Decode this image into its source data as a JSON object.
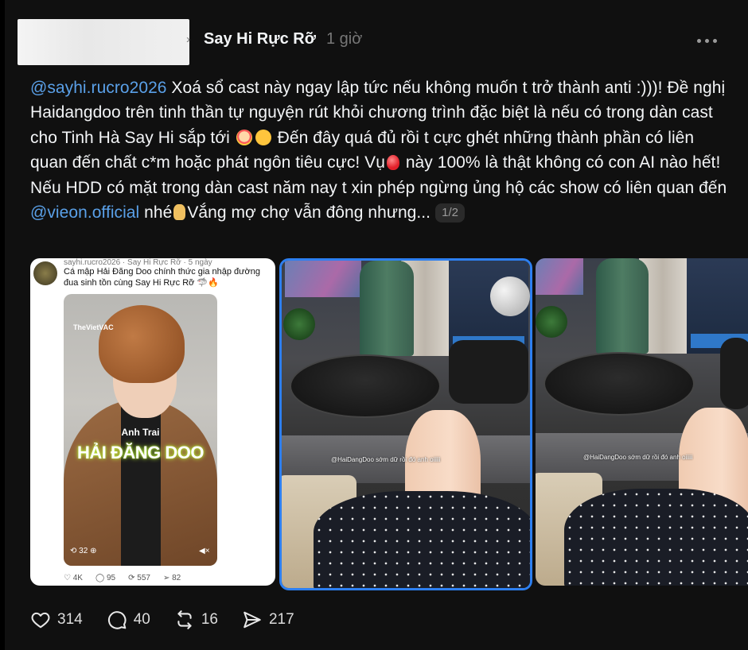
{
  "header": {
    "username": "Say Hi Rực Rỡ",
    "time": "1 giờ"
  },
  "post": {
    "mention_1": "@sayhi.rucro2026",
    "text_1": " Xoá sổ cast này ngay lập tức nếu không muốn t trở thành anti :)))! Đề nghị Haidangdoo trên tinh thần tự nguyện rút khỏi chương trình đặc biệt là nếu có trong dàn cast cho Tinh Hà Say Hi sắp tới",
    "text_2": " Đến đây quá đủ rồi t cực ghét những thành phần có liên quan đến chất c*m hoặc phát ngôn tiêu cực! Vụ",
    "text_3": " này 100% là thật không có con AI nào hết! Nếu HDD có mặt trong dàn cast năm nay t xin phép ngừng ủng hộ các show có liên quan đến ",
    "mention_2": "@vieon.official",
    "text_4": " nhé",
    "text_5": "Vắng mợ chợ vẫn đông nhưng...",
    "page_indicator": "1/2",
    "emoji_icons": [
      "clown-emoji",
      "sad-face-emoji",
      "balloon-emoji",
      "crossed-fingers-emoji"
    ]
  },
  "media": {
    "screenshot": {
      "header": "sayhi.rucro2026 · Say Hi Rực Rỡ · 5 ngày",
      "caption": "Cá mập Hải Đăng Doo chính thức gia nhập đường đua sinh tồn cùng Say Hi Rực Rỡ 🦈🔥",
      "watermark": "TheVietVAC",
      "subtitle": "Anh Trai",
      "title": "HẢI ĐĂNG DOO",
      "views": "32",
      "likes": "4K",
      "comments": "95",
      "reposts": "557",
      "shares": "82"
    },
    "video_caption": "@HaiDangDoo sớm dữ rồi đó anh oiiiii"
  },
  "actions": {
    "likes": "314",
    "comments": "40",
    "reposts": "16",
    "shares": "217"
  }
}
